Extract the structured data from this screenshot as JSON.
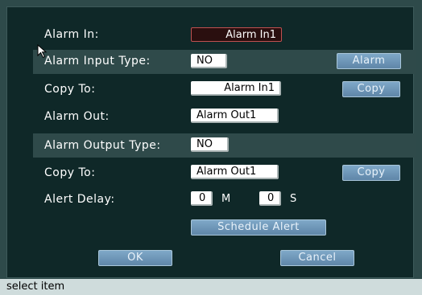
{
  "rows": {
    "alarm_in": {
      "label": "Alarm In:",
      "value": "Alarm In1"
    },
    "alarm_input_type": {
      "label": "Alarm Input Type:",
      "value": "NO",
      "button": "Alarm"
    },
    "copy_to_1": {
      "label": "Copy To:",
      "value": "Alarm In1",
      "button": "Copy"
    },
    "alarm_out": {
      "label": "Alarm Out:",
      "value": "Alarm Out1"
    },
    "alarm_output_type": {
      "label": "Alarm Output Type:",
      "value": "NO"
    },
    "copy_to_2": {
      "label": "Copy To:",
      "value": "Alarm Out1",
      "button": "Copy"
    },
    "alert_delay": {
      "label": "Alert Delay:",
      "minutes": "0",
      "minutes_unit": "M",
      "seconds": "0",
      "seconds_unit": "S"
    }
  },
  "buttons": {
    "schedule_alert": "Schedule Alert",
    "ok": "OK",
    "cancel": "Cancel"
  },
  "status": {
    "text": "select item"
  },
  "colors": {
    "panel": "#0f2828",
    "band": "#2f4a4a",
    "button": "#6f97b8",
    "status_bar": "#cfdcdc"
  }
}
